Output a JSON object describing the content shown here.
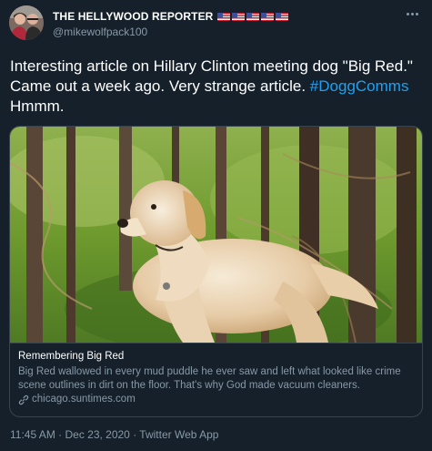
{
  "author": {
    "display_name": "THE HELLYWOOD REPORTER",
    "handle": "@mikewolfpack100",
    "flag_count": 5,
    "flag_icon": "us-flag-icon"
  },
  "tweet": {
    "text_before": "Interesting article on Hillary Clinton  meeting dog \"Big Red.\"  Came out a week ago.  Very strange article. ",
    "hashtag": "#DoggComms",
    "text_after": " Hmmm."
  },
  "card": {
    "title": "Remembering Big Red",
    "description": "Big Red wallowed in every mud puddle he ever saw and left what looked like crime scene outlines in dirt on the floor. That's why God made vacuum cleaners.",
    "domain": "chicago.suntimes.com",
    "image_subject": "golden retriever in a green forest"
  },
  "meta": {
    "timestamp": "11:45 AM · Dec 23, 2020 · Twitter Web App"
  },
  "colors": {
    "background": "#15202b",
    "text_primary": "#ffffff",
    "text_secondary": "#8899a6",
    "accent": "#1da1f2",
    "border": "#38444d"
  }
}
